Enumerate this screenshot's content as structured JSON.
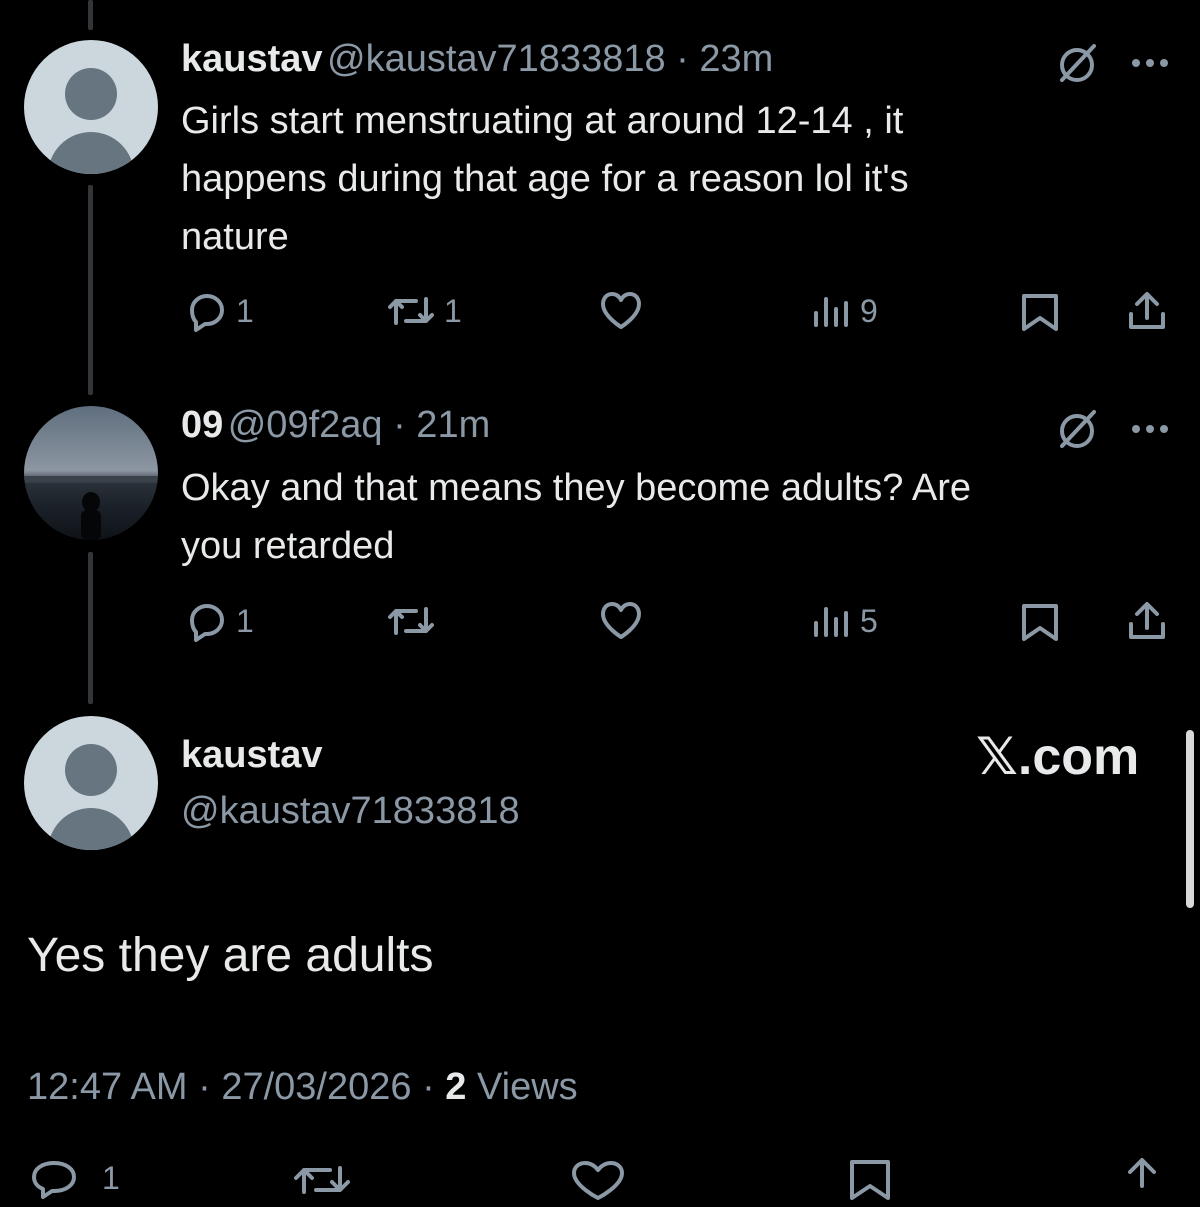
{
  "thread": [
    {
      "name": "kaustav",
      "meta": "@kaustav71833818 · 23m",
      "lines": [
        "Girls start menstruating at around 12-14 , it",
        "happens during that age for a reason lol it's",
        "nature"
      ],
      "replies": "1",
      "reposts": "1",
      "views": "9"
    },
    {
      "name": "09",
      "meta": "@09f2aq · 21m",
      "lines": [
        "Okay and that means they become adults? Are",
        "you retarded"
      ],
      "replies": "1",
      "views": "5"
    }
  ],
  "main": {
    "name": "kaustav",
    "handle": "@kaustav71833818",
    "text": "Yes they are adults",
    "timestamp": "12:47 AM · 27/03/2026 · ",
    "views_count": "2",
    "views_label": " Views",
    "reply_count": "1"
  },
  "watermark": "𝕏.com",
  "icons": [
    "grok-icon",
    "more-icon",
    "reply-icon",
    "repost-icon",
    "like-icon",
    "views-icon",
    "bookmark-icon",
    "share-icon"
  ],
  "colors": {
    "background": "#000000",
    "text": "#e7e9ea",
    "secondary": "#8b98a5",
    "thread_line": "#333639"
  }
}
